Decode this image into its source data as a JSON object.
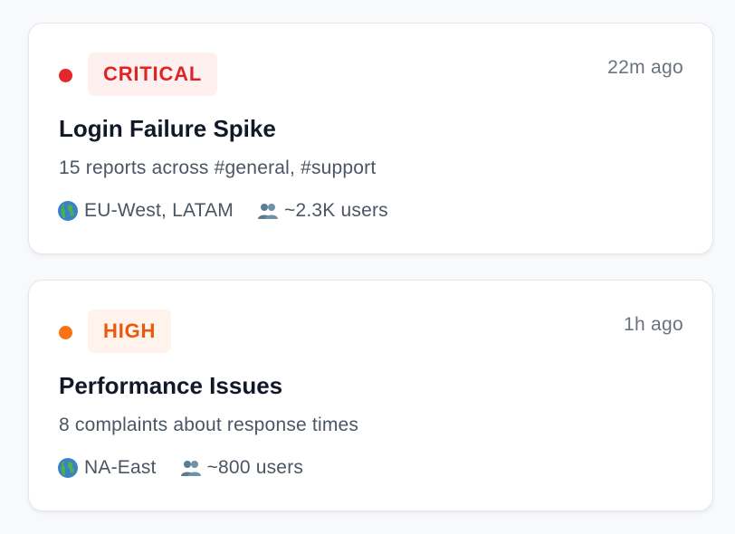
{
  "alerts": [
    {
      "severity": "CRITICAL",
      "severity_color": "#e5262b",
      "badge_bg": "#fef0ef",
      "badge_text_color": "#dc2626",
      "time": "22m ago",
      "title": "Login Failure Spike",
      "description": "15 reports across #general, #support",
      "region_icon": "globe-icon",
      "regions": "EU-West, LATAM",
      "users_icon": "users-icon",
      "users": "~2.3K users"
    },
    {
      "severity": "HIGH",
      "severity_color": "#f97316",
      "badge_bg": "#fff3ec",
      "badge_text_color": "#ea580c",
      "time": "1h ago",
      "title": "Performance Issues",
      "description": "8 complaints about response times",
      "region_icon": "globe-icon",
      "regions": "NA-East",
      "users_icon": "users-icon",
      "users": "~800 users"
    }
  ]
}
